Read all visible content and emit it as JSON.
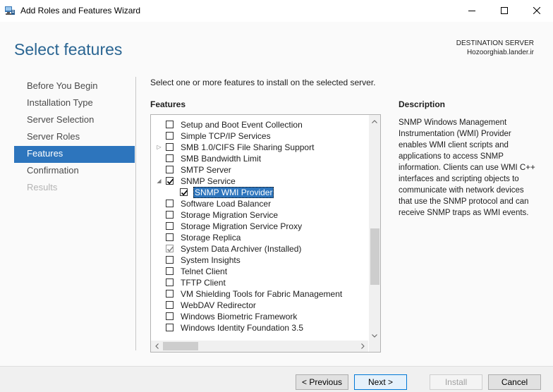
{
  "window": {
    "title": "Add Roles and Features Wizard",
    "controls": {
      "minimize": "minimize-icon",
      "maximize": "maximize-icon",
      "close": "close-icon"
    }
  },
  "header": {
    "page_title": "Select features",
    "destination_label": "DESTINATION SERVER",
    "destination_server": "Hozoorghiab.lander.ir"
  },
  "nav": {
    "items": [
      {
        "label": "Before You Begin",
        "state": "normal"
      },
      {
        "label": "Installation Type",
        "state": "normal"
      },
      {
        "label": "Server Selection",
        "state": "normal"
      },
      {
        "label": "Server Roles",
        "state": "normal"
      },
      {
        "label": "Features",
        "state": "selected"
      },
      {
        "label": "Confirmation",
        "state": "normal"
      },
      {
        "label": "Results",
        "state": "disabled"
      }
    ]
  },
  "main": {
    "instruction": "Select one or more features to install on the selected server.",
    "features_heading": "Features",
    "features": [
      {
        "label": "Setup and Boot Event Collection",
        "checked": false,
        "level": 0
      },
      {
        "label": "Simple TCP/IP Services",
        "checked": false,
        "level": 0
      },
      {
        "label": "SMB 1.0/CIFS File Sharing Support",
        "checked": false,
        "level": 0,
        "expander": "collapsed"
      },
      {
        "label": "SMB Bandwidth Limit",
        "checked": false,
        "level": 0
      },
      {
        "label": "SMTP Server",
        "checked": false,
        "level": 0
      },
      {
        "label": "SNMP Service",
        "checked": true,
        "level": 0,
        "expander": "expanded"
      },
      {
        "label": "SNMP WMI Provider",
        "checked": true,
        "level": 1,
        "highlighted": true
      },
      {
        "label": "Software Load Balancer",
        "checked": false,
        "level": 0
      },
      {
        "label": "Storage Migration Service",
        "checked": false,
        "level": 0
      },
      {
        "label": "Storage Migration Service Proxy",
        "checked": false,
        "level": 0
      },
      {
        "label": "Storage Replica",
        "checked": false,
        "level": 0
      },
      {
        "label": "System Data Archiver (Installed)",
        "checked": true,
        "level": 0,
        "grayed": true
      },
      {
        "label": "System Insights",
        "checked": false,
        "level": 0
      },
      {
        "label": "Telnet Client",
        "checked": false,
        "level": 0
      },
      {
        "label": "TFTP Client",
        "checked": false,
        "level": 0
      },
      {
        "label": "VM Shielding Tools for Fabric Management",
        "checked": false,
        "level": 0
      },
      {
        "label": "WebDAV Redirector",
        "checked": false,
        "level": 0
      },
      {
        "label": "Windows Biometric Framework",
        "checked": false,
        "level": 0
      },
      {
        "label": "Windows Identity Foundation 3.5",
        "checked": false,
        "level": 0
      }
    ],
    "description_heading": "Description",
    "description_text": "SNMP Windows Management Instrumentation (WMI) Provider enables WMI client scripts and applications to access SNMP information. Clients can use WMI C++ interfaces and scripting objects to communicate with network devices that use the SNMP protocol and can receive SNMP traps as WMI events."
  },
  "footer": {
    "previous_label": "< Previous",
    "next_label": "Next >",
    "install_label": "Install",
    "cancel_label": "Cancel"
  },
  "colors": {
    "accent": "#2d75bd",
    "title": "#2a6592",
    "footer_bg": "#f0f0f0"
  }
}
